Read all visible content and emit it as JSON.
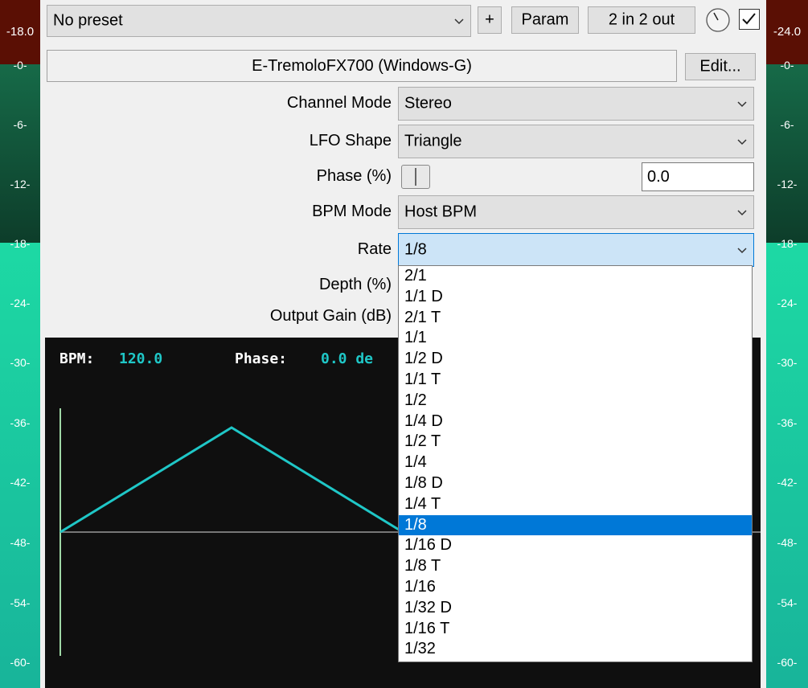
{
  "meters": {
    "left": {
      "peak_label": "-18.0"
    },
    "right": {
      "peak_label": "-24.0"
    },
    "scale": [
      "-0-",
      "-6-",
      "-12-",
      "-18-",
      "-24-",
      "-30-",
      "-36-",
      "-42-",
      "-48-",
      "-54-",
      "-60-"
    ]
  },
  "toolbar": {
    "preset_value": "No preset",
    "plus_label": "+",
    "param_label": "Param",
    "io_label": "2 in 2 out",
    "enabled": true
  },
  "plugin": {
    "title": "E-TremoloFX700 (Windows-G)",
    "edit_label": "Edit..."
  },
  "params": {
    "channel_mode": {
      "label": "Channel Mode",
      "value": "Stereo"
    },
    "lfo_shape": {
      "label": "LFO Shape",
      "value": "Triangle"
    },
    "phase": {
      "label": "Phase (%)",
      "value": "0.0",
      "level": 0.0
    },
    "bpm_mode": {
      "label": "BPM Mode",
      "value": "Host BPM"
    },
    "rate": {
      "label": "Rate",
      "value": "1/8"
    },
    "depth": {
      "label": "Depth (%)"
    },
    "output_gain": {
      "label": "Output Gain (dB)"
    }
  },
  "display": {
    "bpm_label": "BPM:",
    "bpm_value": "120.0",
    "phase_label": "Phase:",
    "phase_value": "0.0 de",
    "wave_color": "#1fc7c7",
    "text_color": "#ffffff",
    "value_color": "#1fc7c7"
  },
  "rate_options": [
    "2/1",
    "1/1 D",
    "2/1 T",
    "1/1",
    "1/2 D",
    "1/1 T",
    "1/2",
    "1/4 D",
    "1/2 T",
    "1/4",
    "1/8 D",
    "1/4 T",
    "1/8",
    "1/16 D",
    "1/8 T",
    "1/16",
    "1/32 D",
    "1/16 T",
    "1/32"
  ],
  "rate_selected_index": 12,
  "colors": {
    "selection": "#0078d7",
    "meter_peak": "#5a0f04",
    "meter_bright": "#1dd9a4"
  }
}
